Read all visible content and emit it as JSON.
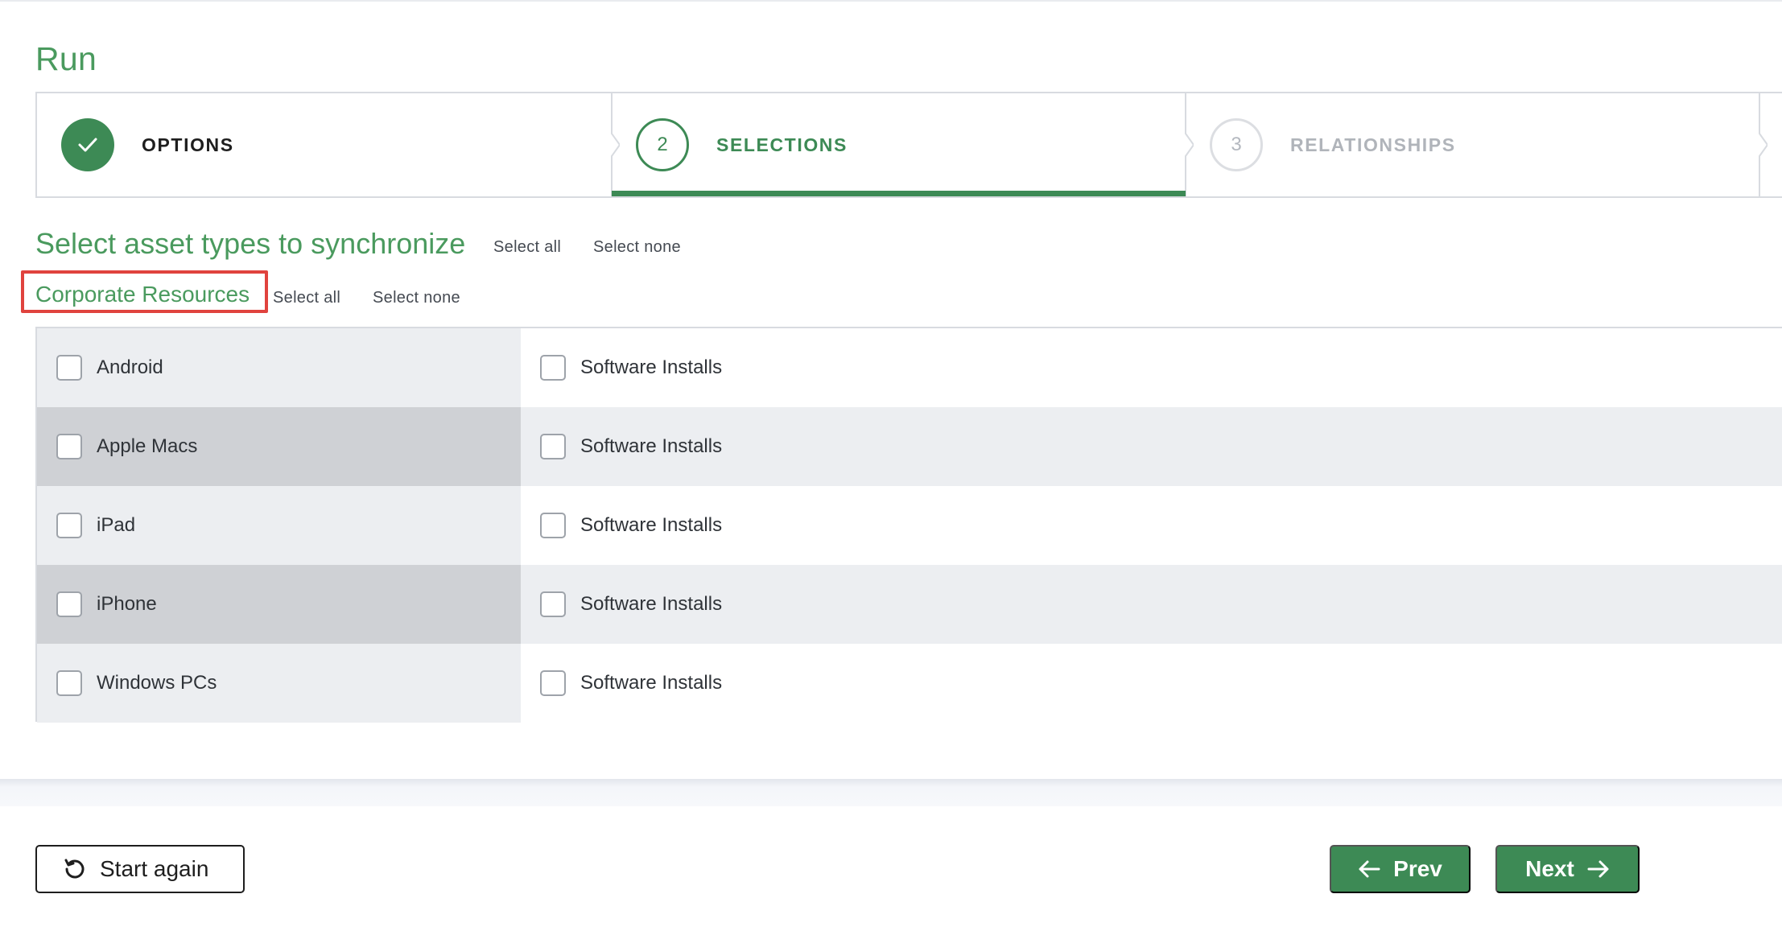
{
  "page": {
    "title": "Run"
  },
  "stepper": {
    "steps": [
      {
        "number": "1",
        "label": "OPTIONS",
        "state": "done"
      },
      {
        "number": "2",
        "label": "SELECTIONS",
        "state": "active"
      },
      {
        "number": "3",
        "label": "RELATIONSHIPS",
        "state": "todo"
      }
    ]
  },
  "section": {
    "title": "Select asset types to synchronize",
    "select_all": "Select all",
    "select_none": "Select none"
  },
  "group": {
    "title": "Corporate Resources",
    "select_all": "Select all",
    "select_none": "Select none"
  },
  "table": {
    "rows": [
      {
        "asset": "Android",
        "sub": "Software Installs"
      },
      {
        "asset": "Apple Macs",
        "sub": "Software Installs"
      },
      {
        "asset": "iPad",
        "sub": "Software Installs"
      },
      {
        "asset": "iPhone",
        "sub": "Software Installs"
      },
      {
        "asset": "Windows PCs",
        "sub": "Software Installs"
      }
    ]
  },
  "footer": {
    "start_again": "Start again",
    "prev": "Prev",
    "next": "Next"
  },
  "colors": {
    "accent": "#3d8a55",
    "title_green": "#4a9a5e",
    "highlight": "#e0433e"
  },
  "icons": {
    "done_step": "check-icon",
    "start_again": "undo-icon",
    "prev": "arrow-left-icon",
    "next": "arrow-right-icon"
  }
}
